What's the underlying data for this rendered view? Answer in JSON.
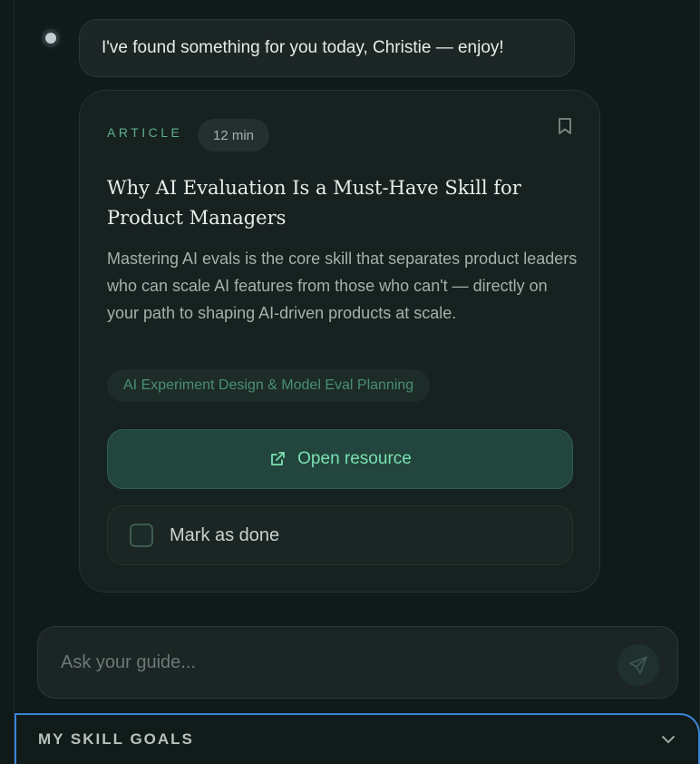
{
  "chat": {
    "greeting": "I've found something for you today, Christie — enjoy!"
  },
  "resource_card": {
    "type_label": "ARTICLE",
    "duration": "12 min",
    "title": "Why AI Evaluation Is a Must-Have Skill for Product Managers",
    "description": "Mastering AI evals is the core skill that separates product leaders who can scale AI features from those who can't — directly on your path to shaping AI-driven products at scale.",
    "skill_tag": "AI Experiment Design & Model Eval Planning",
    "open_button_label": "Open resource",
    "mark_done_label": "Mark as done",
    "mark_done_checked": false
  },
  "composer": {
    "placeholder": "Ask your guide..."
  },
  "skill_goals": {
    "label": "MY SKILL GOALS"
  },
  "colors": {
    "accent_green": "#7be0b3",
    "focus_blue": "#3a84d6",
    "background": "#0f1a19"
  },
  "icons": [
    "bookmark-icon",
    "external-link-icon",
    "send-icon",
    "chevron-down-icon"
  ]
}
